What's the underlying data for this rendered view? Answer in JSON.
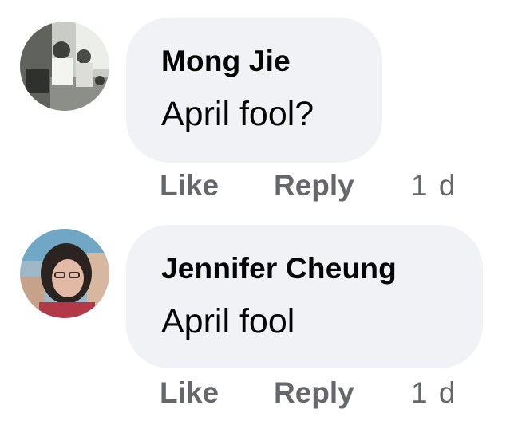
{
  "comments": [
    {
      "author": "Mong Jie",
      "text": "April fool?",
      "like_label": "Like",
      "reply_label": "Reply",
      "time": "1 d"
    },
    {
      "author": "Jennifer Cheung",
      "text": "April fool",
      "like_label": "Like",
      "reply_label": "Reply",
      "time": "1 d"
    }
  ],
  "colors": {
    "bubble": "#f0f2f5",
    "name_text": "#050505",
    "meta_text": "#65676b"
  }
}
